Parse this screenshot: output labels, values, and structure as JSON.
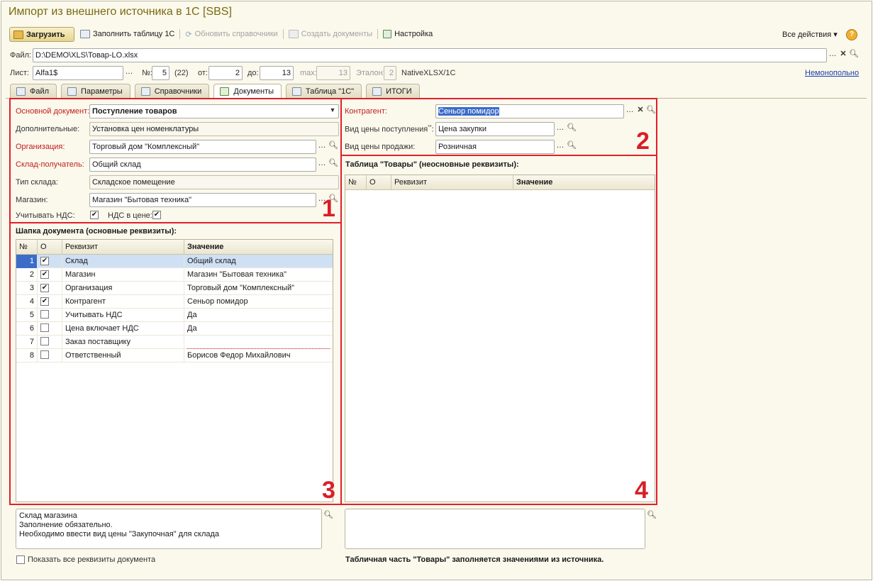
{
  "window": {
    "title": "Импорт из внешнего источника в 1С [SBS]"
  },
  "toolbar": {
    "load": "Загрузить",
    "fill_table": "Заполнить таблицу 1С",
    "refresh_refs": "Обновить справочники",
    "create_docs": "Создать документы",
    "settings": "Настройка",
    "all_actions": "Все действия ▾",
    "help": "?"
  },
  "file": {
    "label": "Файл:",
    "value": "D:\\DEMO\\XLS\\Товар-LO.xlsx"
  },
  "sheet": {
    "label": "Лист:",
    "value": "Alfa1$",
    "no_label": "№:",
    "no_value": "5",
    "no_total": "(22)",
    "from_label": "от:",
    "from_value": "2",
    "to_label": "до:",
    "to_value": "13",
    "max_label": "max:",
    "max_value": "13",
    "etalon_label": "Эталон:",
    "etalon_value": "2",
    "driver": "NativeXLSX/1C",
    "mode_link": "Немонопольно"
  },
  "tabs": [
    "Файл",
    "Параметры",
    "Справочники",
    "Документы",
    "Таблица \"1С\"",
    "ИТОГИ"
  ],
  "doc_params": {
    "main_doc_label": "Основной документ:",
    "main_doc_value": "Поступление товаров",
    "additional_label": "Дополнительные:",
    "additional_value": "Установка цен номенклатуры",
    "org_label": "Организация:",
    "org_value": "Торговый дом \"Комплексный\"",
    "warehouse_label": "Склад-получатель:",
    "warehouse_value": "Общий склад",
    "wh_type_label": "Тип склада:",
    "wh_type_value": "Складское помещение",
    "shop_label": "Магазин:",
    "shop_value": "Магазин \"Бытовая техника\"",
    "vat_label": "Учитывать НДС:",
    "vat_in_price_label": "НДС в цене:"
  },
  "counterparty": {
    "label": "Контрагент:",
    "value": "Сеньор помидор",
    "purchase_price_label": "Вид цены поступления",
    "purchase_price_mark": "**",
    "purchase_price_colon": ":",
    "purchase_price_value": "Цена закупки",
    "sale_price_label": "Вид цены продажи:",
    "sale_price_value": "Розничная"
  },
  "header_table": {
    "title": "Шапка документа (основные реквизиты):",
    "columns": [
      "№",
      "О",
      "Реквизит",
      "Значение"
    ],
    "rows": [
      {
        "n": "1",
        "checked": true,
        "name": "Склад",
        "value": "Общий склад"
      },
      {
        "n": "2",
        "checked": true,
        "name": "Магазин",
        "value": "Магазин \"Бытовая техника\""
      },
      {
        "n": "3",
        "checked": true,
        "name": "Организация",
        "value": "Торговый дом \"Комплексный\""
      },
      {
        "n": "4",
        "checked": true,
        "name": "Контрагент",
        "value": "Сеньор помидор"
      },
      {
        "n": "5",
        "checked": false,
        "name": "Учитывать НДС",
        "value": "Да"
      },
      {
        "n": "6",
        "checked": false,
        "name": "Цена включает НДС",
        "value": "Да"
      },
      {
        "n": "7",
        "checked": false,
        "name": "Заказ поставщику",
        "value": ""
      },
      {
        "n": "8",
        "checked": false,
        "name": "Ответственный",
        "value": "Борисов Федор Михайлович"
      }
    ]
  },
  "goods_table": {
    "title": "Таблица \"Товары\" (неосновные реквизиты):",
    "columns": [
      "№",
      "О",
      "Реквизит",
      "Значение"
    ]
  },
  "markers": [
    "1",
    "2",
    "3",
    "4"
  ],
  "hint_left": [
    "Склад магазина",
    "Заполнение обязательно.",
    "Необходимо ввести вид цены \"Закупочная\" для склада"
  ],
  "show_all_label": "Показать все реквизиты документа",
  "footer_note": "Табличная часть  \"Товары\"  заполняется значениями из источника."
}
